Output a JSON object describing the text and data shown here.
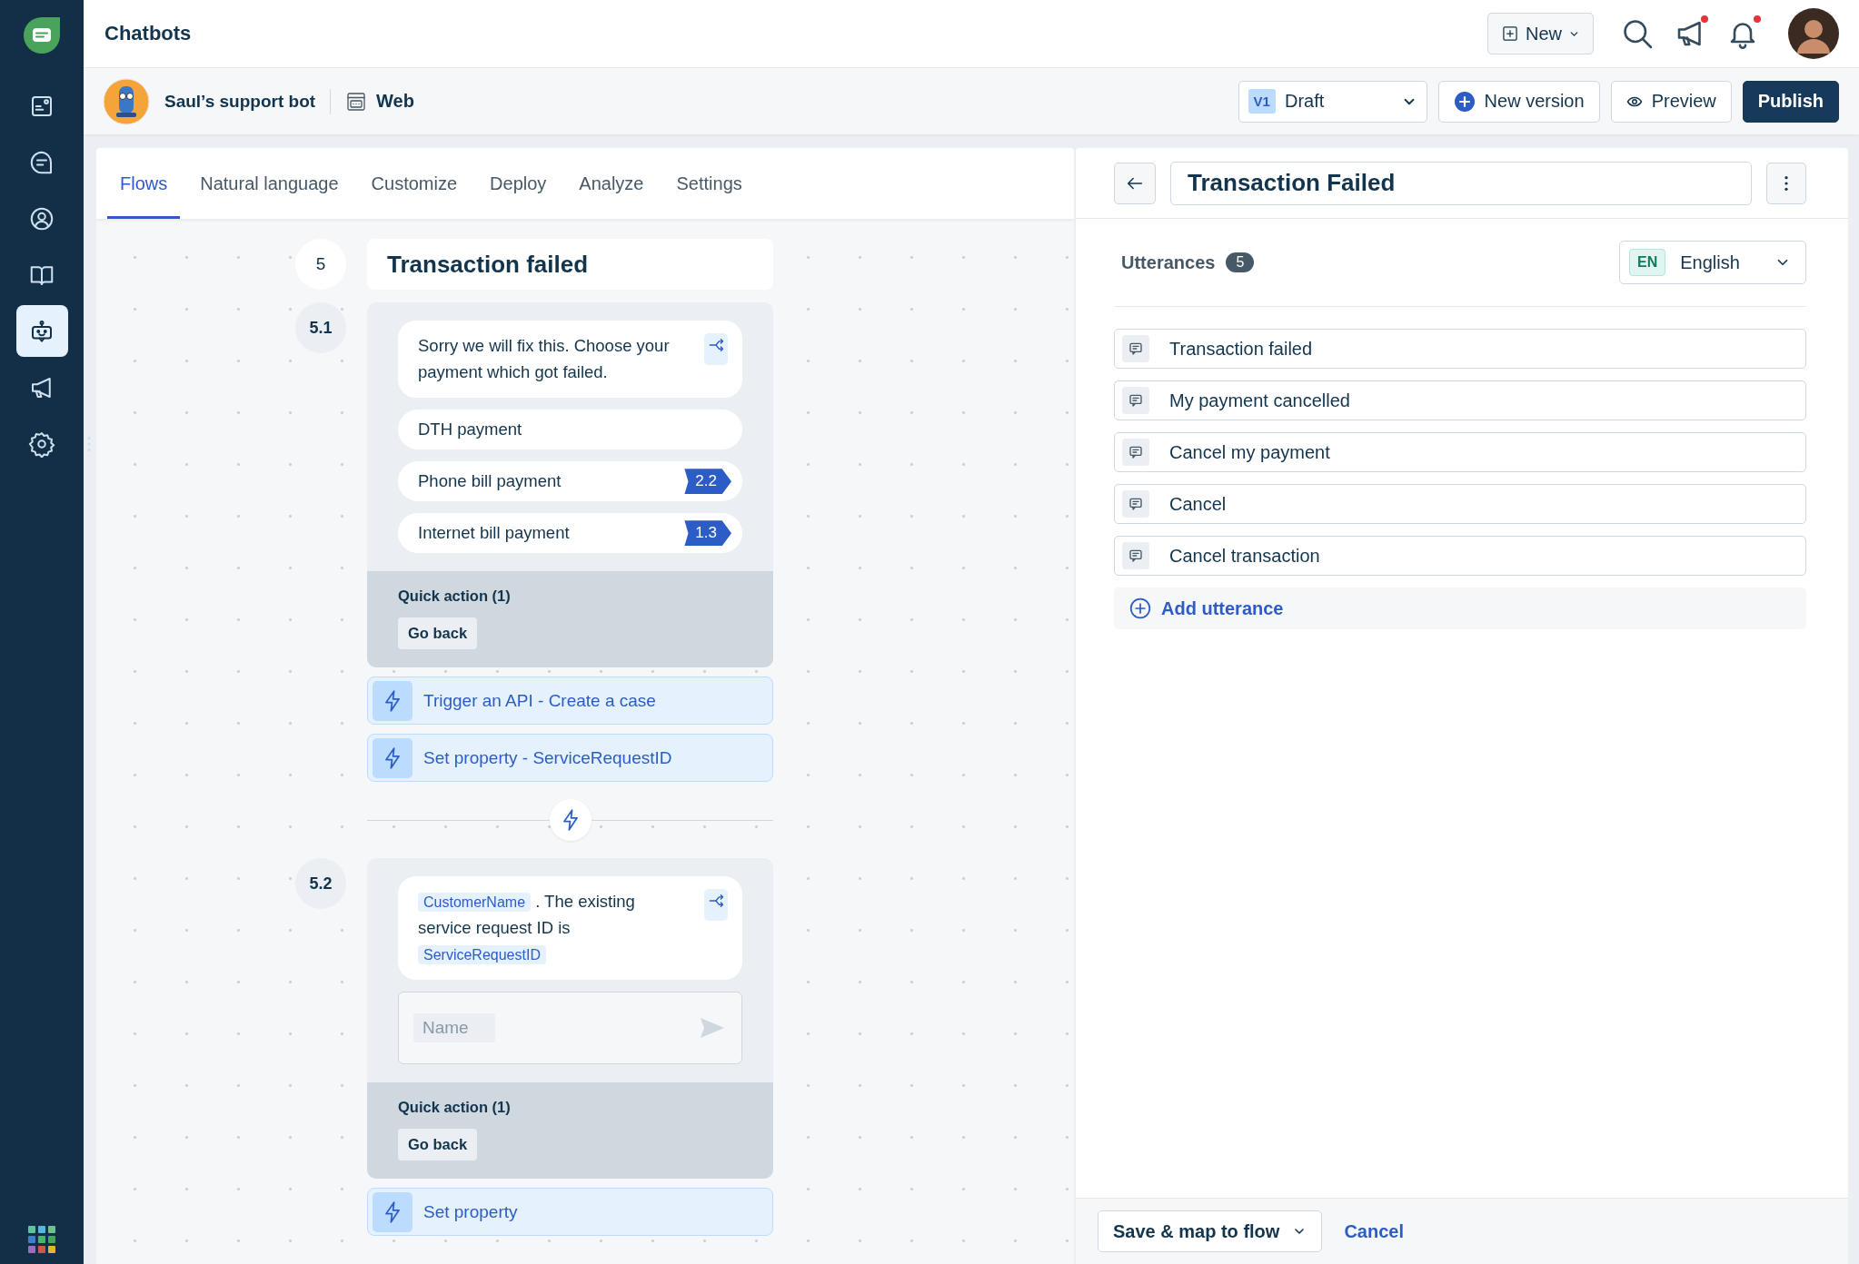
{
  "app": {
    "title": "Chatbots"
  },
  "sidebar": {
    "items": [
      {
        "selected": false
      },
      {
        "selected": false
      },
      {
        "selected": false
      },
      {
        "selected": false
      },
      {
        "selected": true
      },
      {
        "selected": false
      },
      {
        "selected": false
      }
    ]
  },
  "header": {
    "new_button": "New",
    "announcements": {
      "unread": true
    },
    "notifications": {
      "unread": true
    }
  },
  "bot": {
    "name": "Saul’s support bot",
    "channel": "Web"
  },
  "version": {
    "badge": "V1",
    "status": "Draft"
  },
  "toolbar_buttons": [
    {
      "kind": "add",
      "label": "New version"
    },
    {
      "kind": "preview",
      "label": "Preview"
    },
    {
      "kind": "primary",
      "label": "Publish"
    }
  ],
  "tabs": [
    {
      "label": "Flows",
      "selected": true
    },
    {
      "label": "Natural language",
      "selected": false
    },
    {
      "label": "Customize",
      "selected": false
    },
    {
      "label": "Deploy",
      "selected": false
    },
    {
      "label": "Analyze",
      "selected": false
    },
    {
      "label": "Settings",
      "selected": false
    }
  ],
  "flow": {
    "step": {
      "number": "5",
      "title": "Transaction failed"
    },
    "blocks": [
      {
        "number": "5.1",
        "message": [
          {
            "kind": "text",
            "text": "Sorry we will fix this. Choose your payment which got failed."
          }
        ],
        "options": [
          {
            "label": "DTH payment"
          },
          {
            "label": "Phone bill payment",
            "jump": "2.2"
          },
          {
            "label": "Internet bill payment",
            "jump": "1.3"
          }
        ],
        "quick_actions": {
          "title": "Quick action (1)",
          "buttons": [
            "Go back"
          ]
        },
        "actions": [
          {
            "label": "Trigger an API - Create a case"
          },
          {
            "label": "Set property - ServiceRequestID"
          }
        ]
      },
      {
        "number": "5.2",
        "message": [
          {
            "kind": "variable",
            "text": "CustomerName"
          },
          {
            "kind": "text",
            "text": ". The existing service request ID is"
          },
          {
            "kind": "variable",
            "text": "ServiceRequestID"
          }
        ],
        "input": {
          "placeholder": "Name"
        },
        "quick_actions": {
          "title": "Quick action (1)",
          "buttons": [
            "Go back"
          ]
        },
        "actions": [
          {
            "label": "Set property"
          }
        ]
      }
    ]
  },
  "editor": {
    "title": "Transaction Failed",
    "utterances_label": "Utterances",
    "utterance_count": "5",
    "language": {
      "code": "EN",
      "name": "English"
    },
    "utterances": [
      "Transaction failed",
      "My payment cancelled",
      "Cancel my payment",
      "Cancel",
      "Cancel transaction"
    ],
    "add_label": "Add utterance",
    "save_button": "Save & map to flow",
    "cancel_link": "Cancel"
  }
}
